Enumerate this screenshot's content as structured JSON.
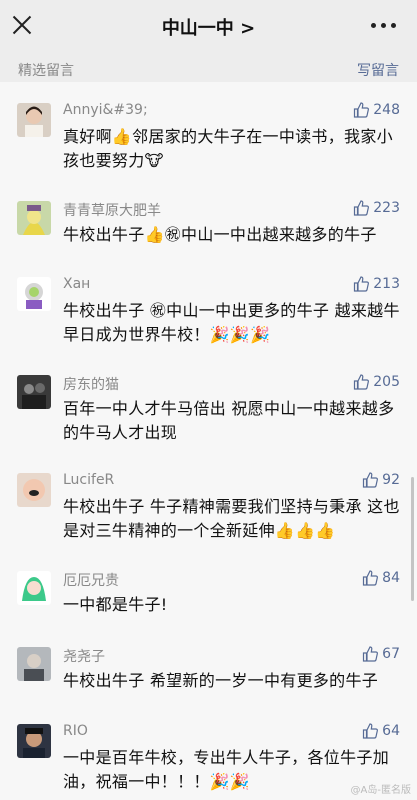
{
  "header": {
    "title": "中山一中 >"
  },
  "section": {
    "label": "精选留言",
    "write_label": "写留言"
  },
  "comments": [
    {
      "name": "Annyi&#39;",
      "likes": "248",
      "text": "真好啊👍邻居家的大牛子在一中读书，我家小孩也要努力🐮"
    },
    {
      "name": "青青草原大肥羊",
      "likes": "223",
      "text": "牛校出牛子👍㊗中山一中出越来越多的牛子"
    },
    {
      "name": "Хан",
      "likes": "213",
      "text": "牛校出牛子 ㊗中山一中出更多的牛子 越来越牛  早日成为世界牛校！🎉🎉🎉"
    },
    {
      "name": "房东的猫",
      "likes": "205",
      "text": "百年一中人才牛马倍出 祝愿中山一中越来越多的牛马人才出现"
    },
    {
      "name": "LucifeR",
      "likes": "92",
      "text": "牛校出牛子 牛子精神需要我们坚持与秉承 这也是对三牛精神的一个全新延伸👍👍👍"
    },
    {
      "name": "厄厄兄贵",
      "likes": "84",
      "text": "一中都是牛子!"
    },
    {
      "name": "尧尧子",
      "likes": "67",
      "text": "牛校出牛子 希望新的一岁一中有更多的牛子"
    },
    {
      "name": "RIO",
      "likes": "64",
      "text": "一中是百年牛校，专出牛人牛子，各位牛子加油，祝福一中！！！🎉🎉"
    }
  ],
  "watermark": "@A岛-匿名版",
  "colors": {
    "link": "#576b95",
    "bg": "#ededed",
    "text": "#111111"
  }
}
